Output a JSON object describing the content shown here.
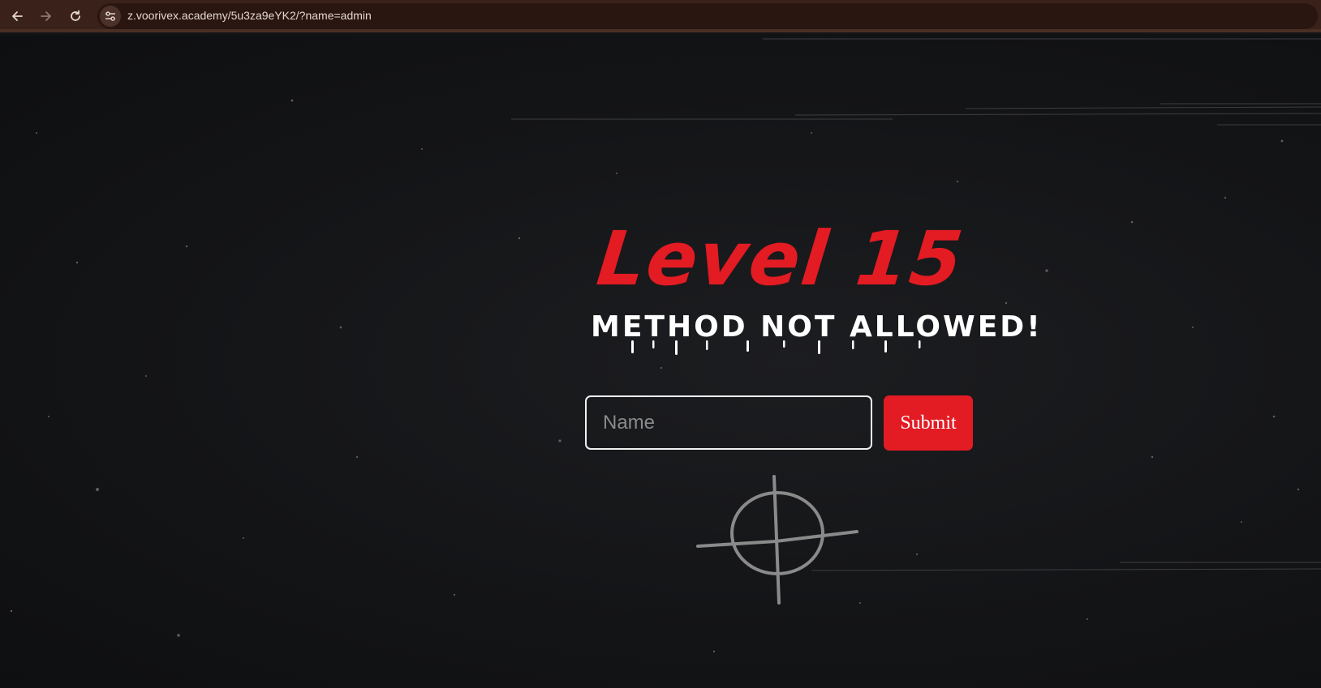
{
  "browser": {
    "url": "z.voorivex.academy/5u3za9eYK2/?name=admin",
    "back_icon": "arrow-left-icon",
    "forward_icon": "arrow-right-icon",
    "reload_icon": "reload-icon",
    "site_info_icon": "tune-icon"
  },
  "challenge": {
    "title": "Level 15",
    "subtitle": "METHOD NOT ALLOWED!",
    "accent_color": "#e31b23"
  },
  "form": {
    "name_placeholder": "Name",
    "name_value": "",
    "submit_label": "Submit"
  },
  "decoration": {
    "symbol_icon": "crosshair-icon"
  }
}
